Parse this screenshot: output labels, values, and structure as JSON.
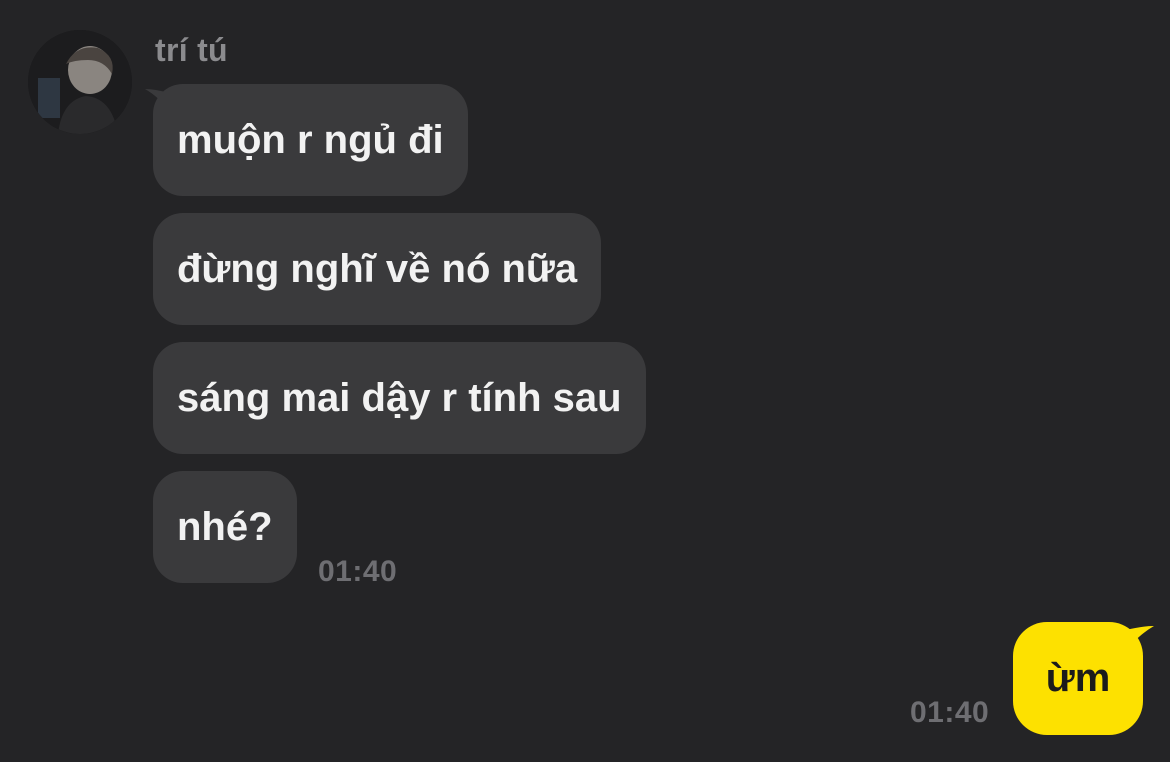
{
  "conversation": {
    "contact_name": "trí tú",
    "avatar_icon": "contact-avatar-photo",
    "incoming_messages": [
      {
        "text": "muộn r ngủ đi"
      },
      {
        "text": "đừng nghĩ về nó nữa"
      },
      {
        "text": "sáng mai dậy r tính sau"
      },
      {
        "text": "nhé?"
      }
    ],
    "incoming_time": "01:40",
    "outgoing_messages": [
      {
        "text": "ừm"
      }
    ],
    "outgoing_time": "01:40"
  },
  "colors": {
    "background": "#242426",
    "incoming_bubble": "#3a3a3c",
    "outgoing_bubble": "#fde100",
    "name_text": "#8b8b8e",
    "timestamp_text": "#6e6e72"
  }
}
